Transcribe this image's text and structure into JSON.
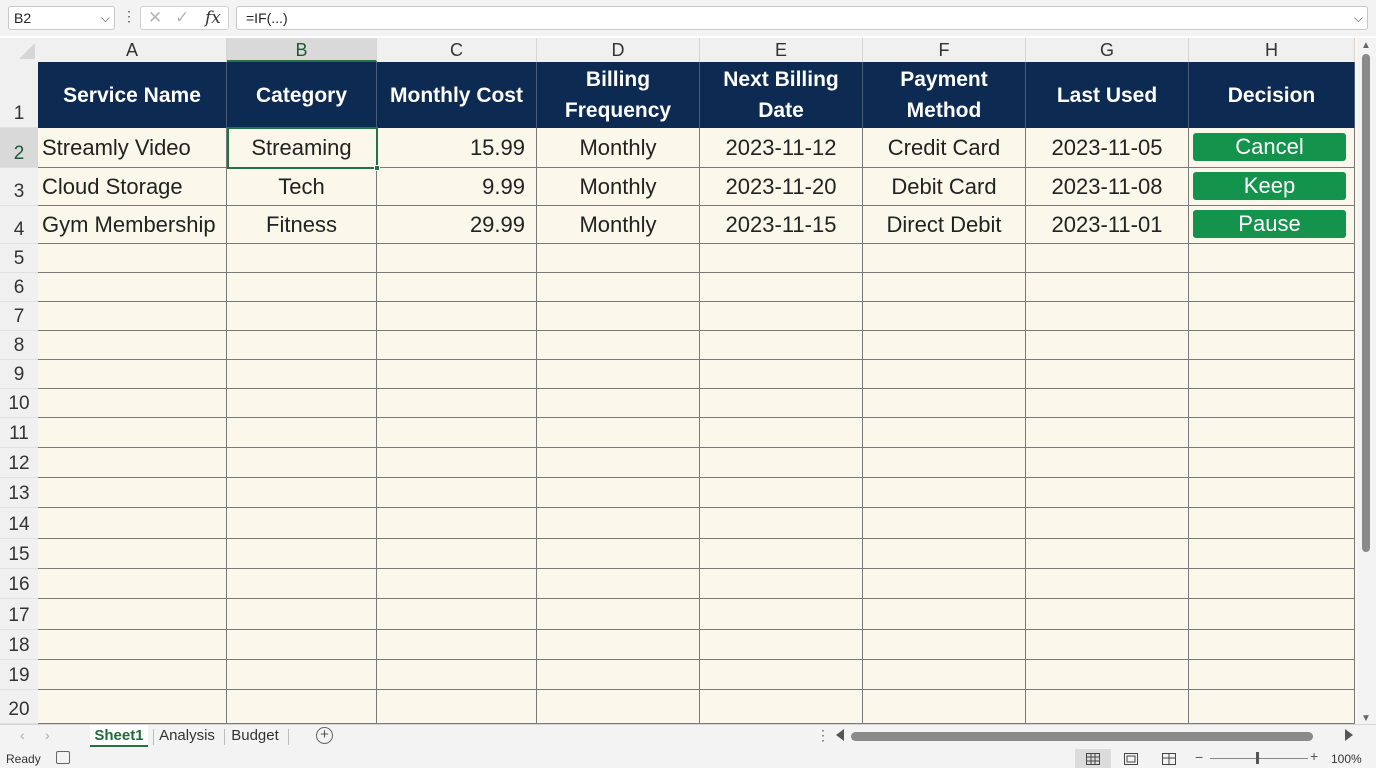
{
  "formula_bar": {
    "name_box": "B2",
    "cancel_glyph": "✕",
    "enter_glyph": "✓",
    "fx_glyph": "fx",
    "formula": "=IF(...)"
  },
  "columns": [
    "A",
    "B",
    "C",
    "D",
    "E",
    "F",
    "G",
    "H"
  ],
  "selected_column": "B",
  "rows": [
    "1",
    "2",
    "3",
    "4",
    "5",
    "6",
    "7",
    "8",
    "9",
    "10",
    "11",
    "12",
    "13",
    "14",
    "15",
    "16",
    "17",
    "18",
    "19",
    "20"
  ],
  "selected_row": "2",
  "table": {
    "headers": [
      "Service Name",
      "Category",
      "Monthly Cost",
      "Billing Frequency",
      "Next Billing Date",
      "Payment Method",
      "Last Used",
      "Decision"
    ],
    "rows": [
      [
        "Streamly Video",
        "Streaming",
        "15.99",
        "Monthly",
        "2023-11-12",
        "Credit Card",
        "2023-11-05",
        "Cancel"
      ],
      [
        "Cloud Storage",
        "Tech",
        "9.99",
        "Monthly",
        "2023-11-20",
        "Debit Card",
        "2023-11-08",
        "Keep"
      ],
      [
        "Gym Membership",
        "Fitness",
        "29.99",
        "Monthly",
        "2023-11-15",
        "Direct Debit",
        "2023-11-01",
        "Pause"
      ]
    ],
    "decision_color": "#13934c",
    "header_color": "#0d2a53"
  },
  "sheet_tabs": [
    {
      "label": "Sheet1",
      "active": true
    },
    {
      "label": "Analysis",
      "active": false
    },
    {
      "label": "Budget",
      "active": false
    }
  ],
  "status_bar": {
    "status": "Ready",
    "zoom": "100%",
    "active_view": "normal"
  },
  "icons": {
    "name_box_dropdown": "chevron-down-icon",
    "add_sheet": "plus-circle-icon",
    "accessibility": "accessibility-check-icon",
    "views": [
      "normal-view-icon",
      "page-layout-icon",
      "page-break-preview-icon"
    ]
  },
  "accent_color": "#217346"
}
